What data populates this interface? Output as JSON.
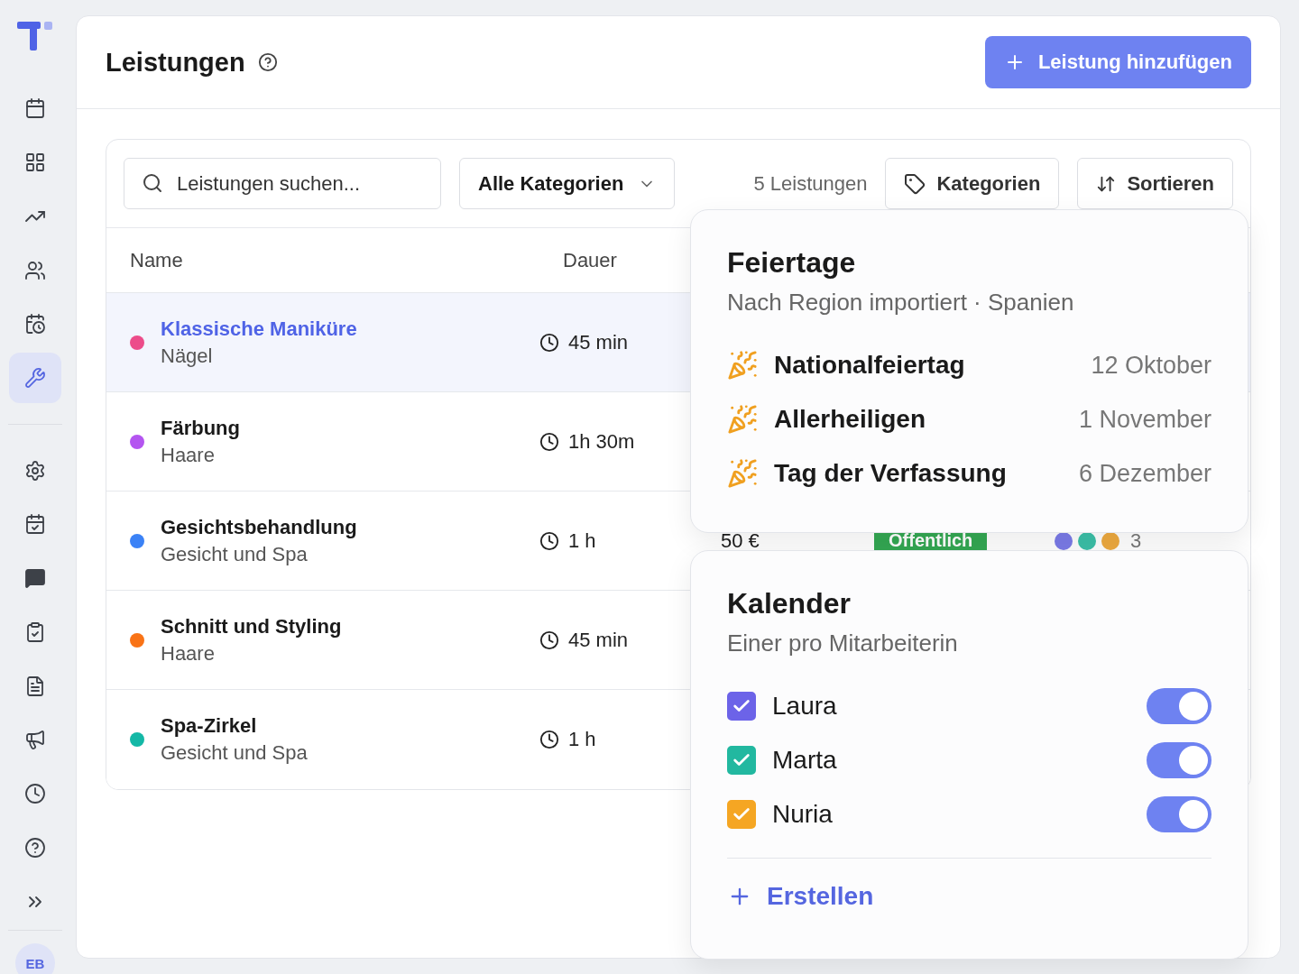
{
  "sidebar": {
    "items": [
      {
        "selected": false
      },
      {
        "selected": false
      },
      {
        "selected": false
      },
      {
        "selected": false
      },
      {
        "selected": false
      },
      {
        "selected": true
      },
      {
        "selected": false
      },
      {
        "selected": false
      },
      {
        "selected": false
      },
      {
        "selected": false
      },
      {
        "selected": false
      },
      {
        "selected": false
      },
      {
        "selected": false
      },
      {
        "selected": false
      },
      {
        "selected": false
      }
    ],
    "avatar": "EB"
  },
  "header": {
    "title": "Leistungen",
    "add_button": "Leistung hinzufügen"
  },
  "toolbar": {
    "search": {
      "placeholder": "Leistungen suchen..."
    },
    "category_select": "Alle Kategorien",
    "count": "5 Leistungen",
    "categories_button": "Kategorien",
    "sort_button": "Sortieren"
  },
  "table": {
    "columns": [
      "Name",
      "Dauer"
    ],
    "rows": [
      {
        "name": "Klassische Maniküre",
        "category": "Nägel",
        "color": "#ec4c8a",
        "duration": "45 min",
        "selected": true
      },
      {
        "name": "Färbung",
        "category": "Haare",
        "color": "#b455f0",
        "duration": "1h 30m",
        "selected": false
      },
      {
        "name": "Gesichtsbehandlung",
        "category": "Gesicht und Spa",
        "color": "#3b82f6",
        "duration": "1 h",
        "selected": false,
        "price": "50 €",
        "status": "Öffentlich",
        "staff": [
          {
            "color": "#7b7be8"
          },
          {
            "color": "#3cc0a8"
          },
          {
            "color": "#eeaa40"
          }
        ],
        "staff_count": "3"
      },
      {
        "name": "Schnitt und Styling",
        "category": "Haare",
        "color": "#f97316",
        "duration": "45 min",
        "selected": false
      },
      {
        "name": "Spa-Zirkel",
        "category": "Gesicht und Spa",
        "color": "#14b8a6",
        "duration": "1 h",
        "selected": false
      }
    ]
  },
  "holidays_popover": {
    "title": "Feiertage",
    "subtitle": "Nach Region importiert · Spanien",
    "items": [
      {
        "name": "Nationalfeiertag",
        "date": "12 Oktober"
      },
      {
        "name": "Allerheiligen",
        "date": "1 November"
      },
      {
        "name": "Tag der Verfassung",
        "date": "6 Dezember"
      }
    ]
  },
  "calendars_popover": {
    "title": "Kalender",
    "subtitle": "Einer pro Mitarbeiterin",
    "calendars": [
      {
        "name": "Laura",
        "color": "#6c63e8",
        "checked": true,
        "on": true
      },
      {
        "name": "Marta",
        "color": "#22b8a0",
        "checked": true,
        "on": true
      },
      {
        "name": "Nuria",
        "color": "#f5a623",
        "checked": true,
        "on": true
      }
    ],
    "create": "Erstellen"
  }
}
